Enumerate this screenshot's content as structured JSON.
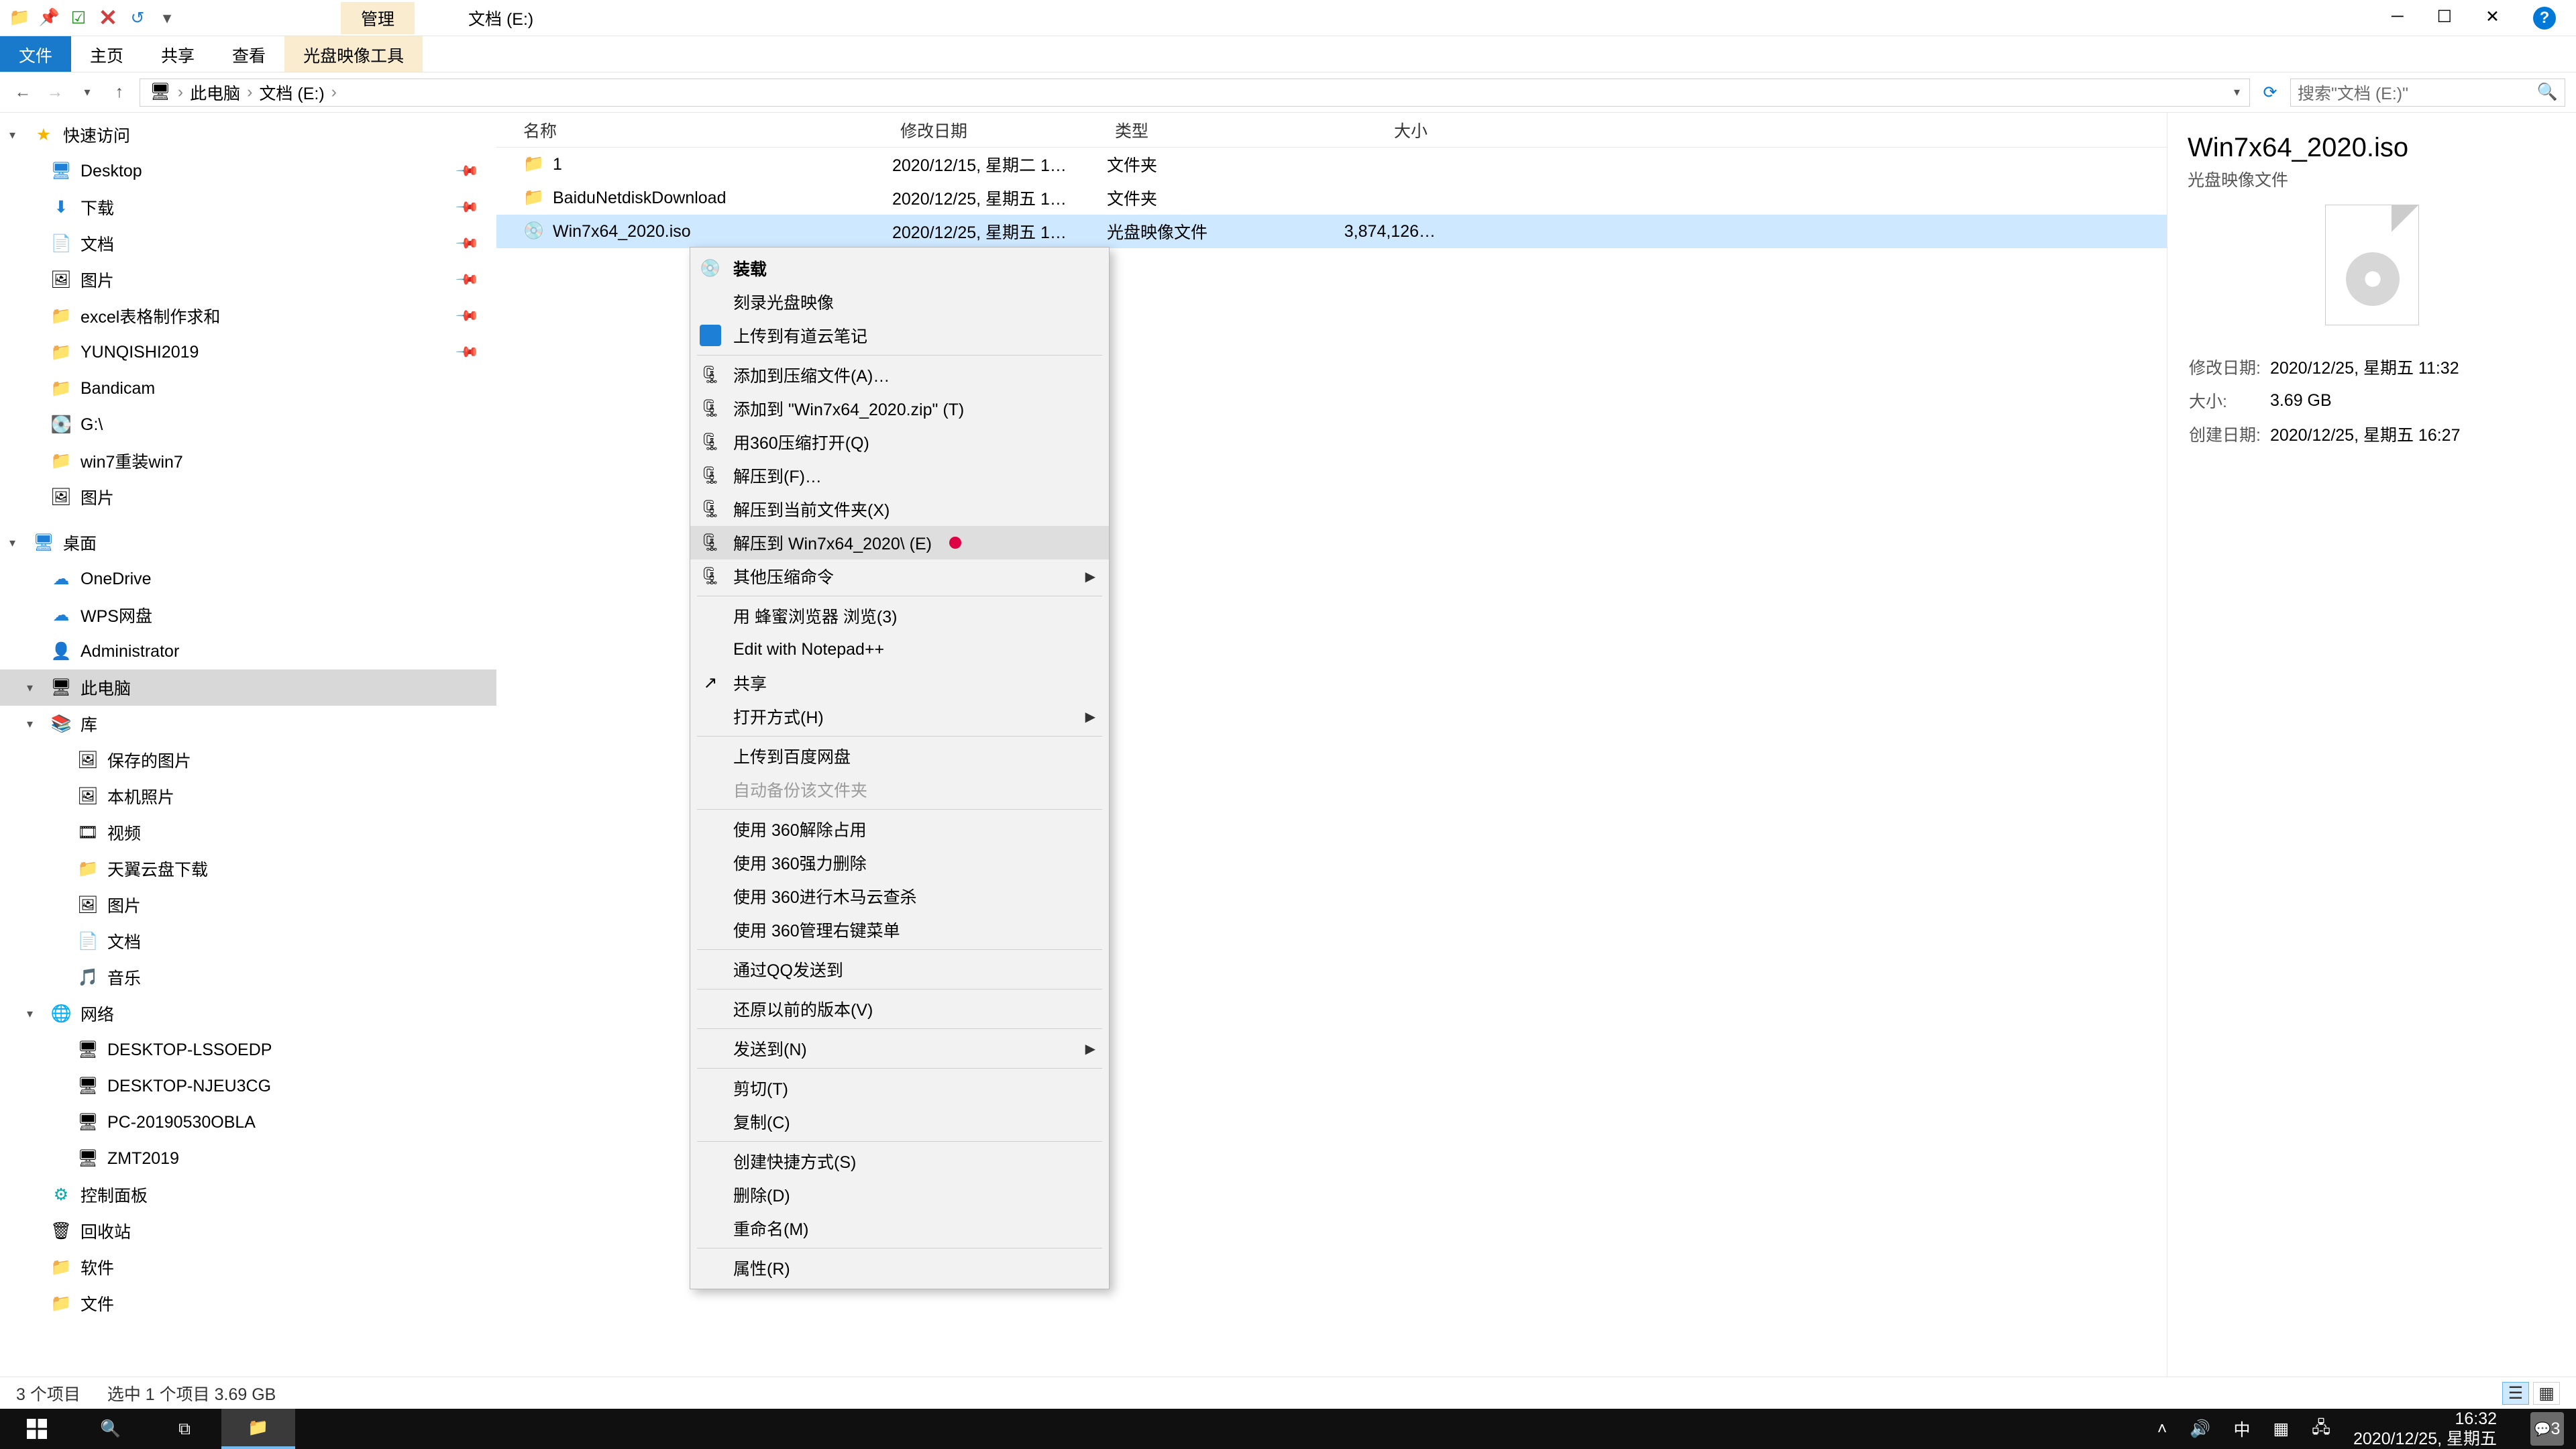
{
  "window": {
    "ctx_tab": "管理",
    "title": "文档 (E:)"
  },
  "ribbon": {
    "file": "文件",
    "tabs": [
      "主页",
      "共享",
      "查看"
    ],
    "ctx": "光盘映像工具"
  },
  "address": {
    "crumbs": [
      "此电脑",
      "文档 (E:)"
    ],
    "search_placeholder": "搜索\"文档 (E:)\""
  },
  "nav": {
    "quick": {
      "label": "快速访问",
      "items": [
        {
          "label": "Desktop",
          "icon": "i-desktop",
          "pinned": true
        },
        {
          "label": "下载",
          "icon": "i-dl",
          "pinned": true
        },
        {
          "label": "文档",
          "icon": "i-doc",
          "pinned": true
        },
        {
          "label": "图片",
          "icon": "i-pic",
          "pinned": true
        },
        {
          "label": "excel表格制作求和",
          "icon": "i-folder",
          "pinned": true
        },
        {
          "label": "YUNQISHI2019",
          "icon": "i-folder",
          "pinned": true
        },
        {
          "label": "Bandicam",
          "icon": "i-folder"
        },
        {
          "label": "G:\\",
          "icon": "i-disk"
        },
        {
          "label": "win7重装win7",
          "icon": "i-folder"
        },
        {
          "label": "图片",
          "icon": "i-pic"
        }
      ]
    },
    "desktop": {
      "label": "桌面",
      "items": [
        {
          "label": "OneDrive",
          "icon": "i-cloud"
        },
        {
          "label": "WPS网盘",
          "icon": "i-cloud"
        },
        {
          "label": "Administrator",
          "icon": "i-user"
        },
        {
          "label": "此电脑",
          "icon": "i-pc",
          "selected": true
        },
        {
          "label": "库",
          "icon": "i-lib",
          "items": [
            {
              "label": "保存的图片",
              "icon": "i-pic"
            },
            {
              "label": "本机照片",
              "icon": "i-pic"
            },
            {
              "label": "视频",
              "icon": "i-video"
            },
            {
              "label": "天翼云盘下载",
              "icon": "i-folder"
            },
            {
              "label": "图片",
              "icon": "i-pic"
            },
            {
              "label": "文档",
              "icon": "i-doc"
            },
            {
              "label": "音乐",
              "icon": "i-music"
            }
          ]
        },
        {
          "label": "网络",
          "icon": "i-net",
          "items": [
            {
              "label": "DESKTOP-LSSOEDP",
              "icon": "i-pc"
            },
            {
              "label": "DESKTOP-NJEU3CG",
              "icon": "i-pc"
            },
            {
              "label": "PC-20190530OBLA",
              "icon": "i-pc"
            },
            {
              "label": "ZMT2019",
              "icon": "i-pc"
            }
          ]
        },
        {
          "label": "控制面板",
          "icon": "i-cp"
        },
        {
          "label": "回收站",
          "icon": "i-recycle"
        },
        {
          "label": "软件",
          "icon": "i-folder"
        },
        {
          "label": "文件",
          "icon": "i-folder"
        }
      ]
    }
  },
  "columns": {
    "name": "名称",
    "date": "修改日期",
    "type": "类型",
    "size": "大小"
  },
  "rows": [
    {
      "name": "1",
      "date": "2020/12/15, 星期二 1…",
      "type": "文件夹",
      "size": "",
      "icon": "i-folder"
    },
    {
      "name": "BaiduNetdiskDownload",
      "date": "2020/12/25, 星期五 1…",
      "type": "文件夹",
      "size": "",
      "icon": "i-folder"
    },
    {
      "name": "Win7x64_2020.iso",
      "date": "2020/12/25, 星期五 1…",
      "type": "光盘映像文件",
      "size": "3,874,126…",
      "icon": "i-cd",
      "selected": true
    }
  ],
  "details": {
    "title": "Win7x64_2020.iso",
    "subtitle": "光盘映像文件",
    "rows": [
      {
        "k": "修改日期:",
        "v": "2020/12/25, 星期五 11:32"
      },
      {
        "k": "大小:",
        "v": "3.69 GB"
      },
      {
        "k": "创建日期:",
        "v": "2020/12/25, 星期五 16:27"
      }
    ]
  },
  "context_menu": [
    {
      "label": "装载",
      "icon": "i-cd",
      "bold": true
    },
    {
      "label": "刻录光盘映像"
    },
    {
      "label": "上传到有道云笔记",
      "icon_color": "#1e7fd6"
    },
    {
      "sep": true
    },
    {
      "label": "添加到压缩文件(A)…",
      "icon": "i-zip"
    },
    {
      "label": "添加到 \"Win7x64_2020.zip\" (T)",
      "icon": "i-zip"
    },
    {
      "label": "用360压缩打开(Q)",
      "icon": "i-zip"
    },
    {
      "label": "解压到(F)…",
      "icon": "i-zip"
    },
    {
      "label": "解压到当前文件夹(X)",
      "icon": "i-zip"
    },
    {
      "label": "解压到 Win7x64_2020\\ (E)",
      "icon": "i-zip",
      "hover": true
    },
    {
      "label": "其他压缩命令",
      "icon": "i-zip",
      "submenu": true
    },
    {
      "sep": true
    },
    {
      "label": "用 蜂蜜浏览器 浏览(3)"
    },
    {
      "label": "Edit with Notepad++"
    },
    {
      "label": "共享",
      "icon": "i-share"
    },
    {
      "label": "打开方式(H)",
      "submenu": true
    },
    {
      "sep": true
    },
    {
      "label": "上传到百度网盘"
    },
    {
      "label": "自动备份该文件夹",
      "disabled": true
    },
    {
      "sep": true
    },
    {
      "label": "使用 360解除占用"
    },
    {
      "label": "使用 360强力删除"
    },
    {
      "label": "使用 360进行木马云查杀"
    },
    {
      "label": "使用 360管理右键菜单"
    },
    {
      "sep": true
    },
    {
      "label": "通过QQ发送到"
    },
    {
      "sep": true
    },
    {
      "label": "还原以前的版本(V)"
    },
    {
      "sep": true
    },
    {
      "label": "发送到(N)",
      "submenu": true
    },
    {
      "sep": true
    },
    {
      "label": "剪切(T)"
    },
    {
      "label": "复制(C)"
    },
    {
      "sep": true
    },
    {
      "label": "创建快捷方式(S)"
    },
    {
      "label": "删除(D)"
    },
    {
      "label": "重命名(M)"
    },
    {
      "sep": true
    },
    {
      "label": "属性(R)"
    }
  ],
  "status": {
    "count": "3 个项目",
    "selection": "选中 1 个项目  3.69 GB"
  },
  "taskbar": {
    "ime": "中",
    "time": "16:32",
    "date": "2020/12/25, 星期五",
    "notif_badge": "3"
  }
}
